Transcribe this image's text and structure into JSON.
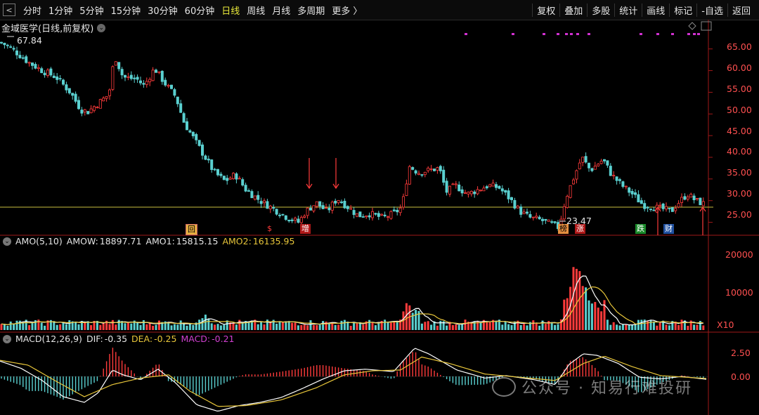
{
  "nav": {
    "back_icon": "chevron-left-icon",
    "back_glyph": "<"
  },
  "timeframes": [
    {
      "label": "分时",
      "active": false
    },
    {
      "label": "1分钟",
      "active": false
    },
    {
      "label": "5分钟",
      "active": false
    },
    {
      "label": "15分钟",
      "active": false
    },
    {
      "label": "30分钟",
      "active": false
    },
    {
      "label": "60分钟",
      "active": false
    },
    {
      "label": "日线",
      "active": true
    },
    {
      "label": "周线",
      "active": false
    },
    {
      "label": "月线",
      "active": false
    },
    {
      "label": "多周期",
      "active": false
    },
    {
      "label": "更多 〉",
      "active": false
    }
  ],
  "tools": [
    "复权",
    "叠加",
    "多股",
    "统计",
    "画线",
    "标记",
    "-自选",
    "返回"
  ],
  "stock_title": "金域医学(日线,前复权)",
  "price_panel": {
    "high_label": "67.84",
    "low_label": "23.47",
    "y_ticks": [
      "65.00",
      "60.00",
      "55.00",
      "50.00",
      "45.00",
      "40.00",
      "35.00",
      "30.00",
      "25.00"
    ],
    "markers": [
      "回",
      "$",
      "增",
      "榜",
      "涨",
      "跌",
      "财"
    ]
  },
  "amo_panel": {
    "title": "AMO(5,10)",
    "amow_label": "AMOW:",
    "amow": "18897.71",
    "amo1_label": "AMO1:",
    "amo1": "15815.15",
    "amo2_label": "AMO2:",
    "amo2": "16135.95",
    "y_ticks": [
      "20000",
      "10000"
    ],
    "unit": "X10"
  },
  "macd_panel": {
    "title": "MACD(12,26,9)",
    "dif_label": "DIF:",
    "dif": "-0.35",
    "dea_label": "DEA:",
    "dea": "-0.25",
    "macd_label": "MACD:",
    "macd": "-0.21",
    "y_ticks": [
      "2.50",
      "0.00"
    ]
  },
  "watermark": "公众号 · 知易行难投研",
  "colors": {
    "up": "#ff3b3b",
    "down": "#5ad0d0",
    "ma1": "#ffffff",
    "ma2": "#e8c63a",
    "macd_label": "#d040d0",
    "accent_yellow": "#e8e83a",
    "axis_red": "#a01818",
    "marker_magenta": "#d030d0"
  },
  "chart_data": {
    "type": "candlestick",
    "price_range": [
      22.5,
      69.0
    ],
    "price_path": [
      [
        0,
        66.5
      ],
      [
        10,
        65.8
      ],
      [
        25,
        64.0
      ],
      [
        40,
        62.0
      ],
      [
        60,
        60.0
      ],
      [
        80,
        58.5
      ],
      [
        100,
        55.0
      ],
      [
        115,
        51.0
      ],
      [
        125,
        50.5
      ],
      [
        140,
        52.5
      ],
      [
        155,
        54.5
      ],
      [
        163,
        63.5
      ],
      [
        175,
        58.5
      ],
      [
        195,
        58.0
      ],
      [
        205,
        56.5
      ],
      [
        220,
        60.5
      ],
      [
        235,
        57.0
      ],
      [
        250,
        54.0
      ],
      [
        262,
        48.0
      ],
      [
        275,
        44.5
      ],
      [
        290,
        40.5
      ],
      [
        305,
        36.5
      ],
      [
        320,
        34.5
      ],
      [
        335,
        36.0
      ],
      [
        350,
        32.5
      ],
      [
        370,
        30.0
      ],
      [
        390,
        28.0
      ],
      [
        410,
        26.0
      ],
      [
        425,
        25.0
      ],
      [
        435,
        27.5
      ],
      [
        450,
        29.5
      ],
      [
        465,
        27.5
      ],
      [
        480,
        30.5
      ],
      [
        495,
        28.5
      ],
      [
        510,
        26.5
      ],
      [
        525,
        27.0
      ],
      [
        545,
        26.0
      ],
      [
        560,
        27.0
      ],
      [
        572,
        28.5
      ],
      [
        582,
        38.0
      ],
      [
        595,
        36.5
      ],
      [
        610,
        37.0
      ],
      [
        625,
        37.5
      ],
      [
        635,
        32.0
      ],
      [
        648,
        33.5
      ],
      [
        665,
        31.5
      ],
      [
        680,
        32.5
      ],
      [
        695,
        33.5
      ],
      [
        710,
        33.0
      ],
      [
        725,
        30.5
      ],
      [
        740,
        27.5
      ],
      [
        755,
        26.0
      ],
      [
        770,
        25.5
      ],
      [
        785,
        24.5
      ],
      [
        795,
        23.8
      ],
      [
        805,
        30.5
      ],
      [
        818,
        36.0
      ],
      [
        828,
        40.0
      ],
      [
        840,
        37.0
      ],
      [
        858,
        39.5
      ],
      [
        870,
        36.0
      ],
      [
        885,
        33.5
      ],
      [
        900,
        31.5
      ],
      [
        915,
        29.0
      ],
      [
        930,
        28.5
      ],
      [
        945,
        28.0
      ],
      [
        955,
        27.5
      ],
      [
        965,
        29.5
      ],
      [
        978,
        31.5
      ],
      [
        990,
        30.0
      ],
      [
        1005,
        29.0
      ]
    ],
    "support_line": 28.5,
    "arrows_down": [
      440,
      478
    ],
    "arrows_up": [
      936,
      1000
    ],
    "amo_range": [
      0,
      23000
    ],
    "amo_spikes": [
      [
        292,
        4500
      ],
      [
        580,
        8500
      ],
      [
        810,
        11000
      ],
      [
        818,
        20500
      ],
      [
        825,
        17000
      ],
      [
        832,
        13500
      ],
      [
        845,
        9000
      ]
    ],
    "macd_range": [
      -4.5,
      4.0
    ],
    "dif_path": [
      [
        0,
        1.9
      ],
      [
        30,
        1.0
      ],
      [
        60,
        -0.5
      ],
      [
        90,
        -2.5
      ],
      [
        120,
        -3.2
      ],
      [
        140,
        -2.0
      ],
      [
        160,
        0.8
      ],
      [
        175,
        0.2
      ],
      [
        200,
        -0.4
      ],
      [
        225,
        0.9
      ],
      [
        250,
        -0.8
      ],
      [
        280,
        -3.5
      ],
      [
        310,
        -4.3
      ],
      [
        340,
        -3.6
      ],
      [
        370,
        -3.2
      ],
      [
        400,
        -2.6
      ],
      [
        430,
        -1.5
      ],
      [
        460,
        -0.3
      ],
      [
        490,
        0.7
      ],
      [
        520,
        0.9
      ],
      [
        560,
        0.6
      ],
      [
        590,
        3.5
      ],
      [
        610,
        2.8
      ],
      [
        650,
        0.8
      ],
      [
        690,
        -0.2
      ],
      [
        720,
        0.1
      ],
      [
        760,
        -0.4
      ],
      [
        790,
        -1.0
      ],
      [
        810,
        1.5
      ],
      [
        830,
        2.8
      ],
      [
        850,
        2.6
      ],
      [
        880,
        1.6
      ],
      [
        910,
        -0.1
      ],
      [
        940,
        -0.3
      ],
      [
        970,
        0.0
      ],
      [
        1005,
        -0.35
      ]
    ],
    "dea_path": [
      [
        0,
        2.0
      ],
      [
        40,
        1.4
      ],
      [
        80,
        -0.6
      ],
      [
        120,
        -2.5
      ],
      [
        160,
        -1.0
      ],
      [
        200,
        -0.2
      ],
      [
        240,
        0.2
      ],
      [
        270,
        -1.8
      ],
      [
        310,
        -3.7
      ],
      [
        350,
        -3.6
      ],
      [
        400,
        -2.9
      ],
      [
        450,
        -1.4
      ],
      [
        490,
        0.2
      ],
      [
        530,
        0.7
      ],
      [
        570,
        0.8
      ],
      [
        600,
        2.4
      ],
      [
        640,
        1.6
      ],
      [
        690,
        0.3
      ],
      [
        740,
        -0.1
      ],
      [
        790,
        -0.5
      ],
      [
        830,
        1.6
      ],
      [
        860,
        2.5
      ],
      [
        900,
        1.2
      ],
      [
        940,
        0.1
      ],
      [
        1005,
        -0.25
      ]
    ]
  }
}
